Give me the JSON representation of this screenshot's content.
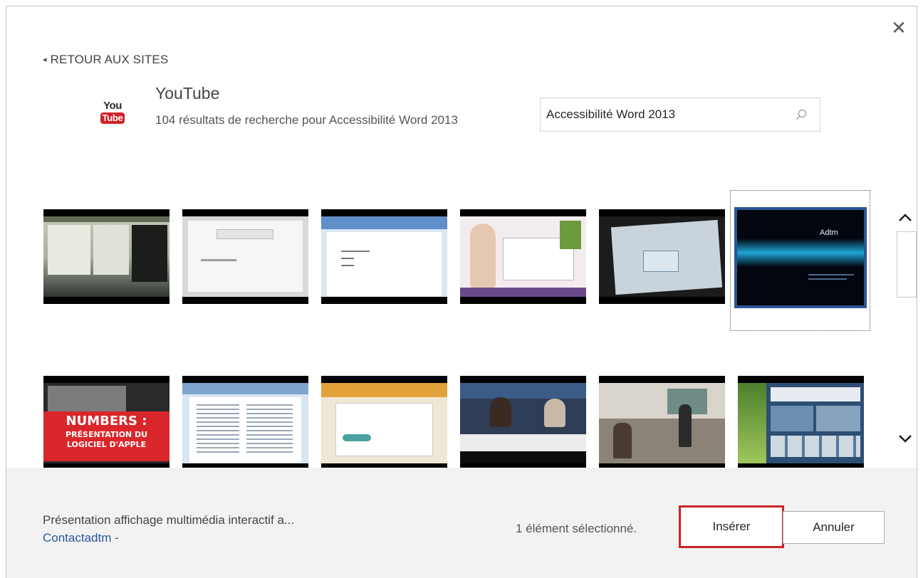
{
  "dialog": {
    "close_icon": "close-icon"
  },
  "nav": {
    "back_label": "RETOUR AUX SITES",
    "back_arrow": "◂"
  },
  "site": {
    "logo_top": "You",
    "logo_bottom": "Tube",
    "name": "YouTube",
    "results": "104 résultats de recherche pour Accessibilité Word 2013"
  },
  "search": {
    "value": "Accessibilité Word 2013",
    "icon": "search-icon"
  },
  "thumbnails_row1": [
    "video-1",
    "video-2",
    "video-3",
    "video-4",
    "video-5",
    "video-6"
  ],
  "thumbnails_row2": [
    "video-7",
    "video-8",
    "video-9",
    "video-10",
    "video-11",
    "video-12"
  ],
  "thumb_text": {
    "numbers_top": "NUMBERS :",
    "numbers_line2": "PRÉSENTATION DU",
    "numbers_line3": "LOGICIEL D'APPLE",
    "adtm": "Adtm"
  },
  "footer": {
    "description": "Présentation affichage multimédia interactif a...",
    "author": "Contactadtm -",
    "selection_count": "1 élément sélectionné.",
    "insert_label": "Insérer",
    "cancel_label": "Annuler"
  },
  "colors": {
    "accent_red": "#c9242b",
    "link_blue": "#2b579a",
    "selection_blue": "#2d5496",
    "youtube_red": "#d12127"
  }
}
